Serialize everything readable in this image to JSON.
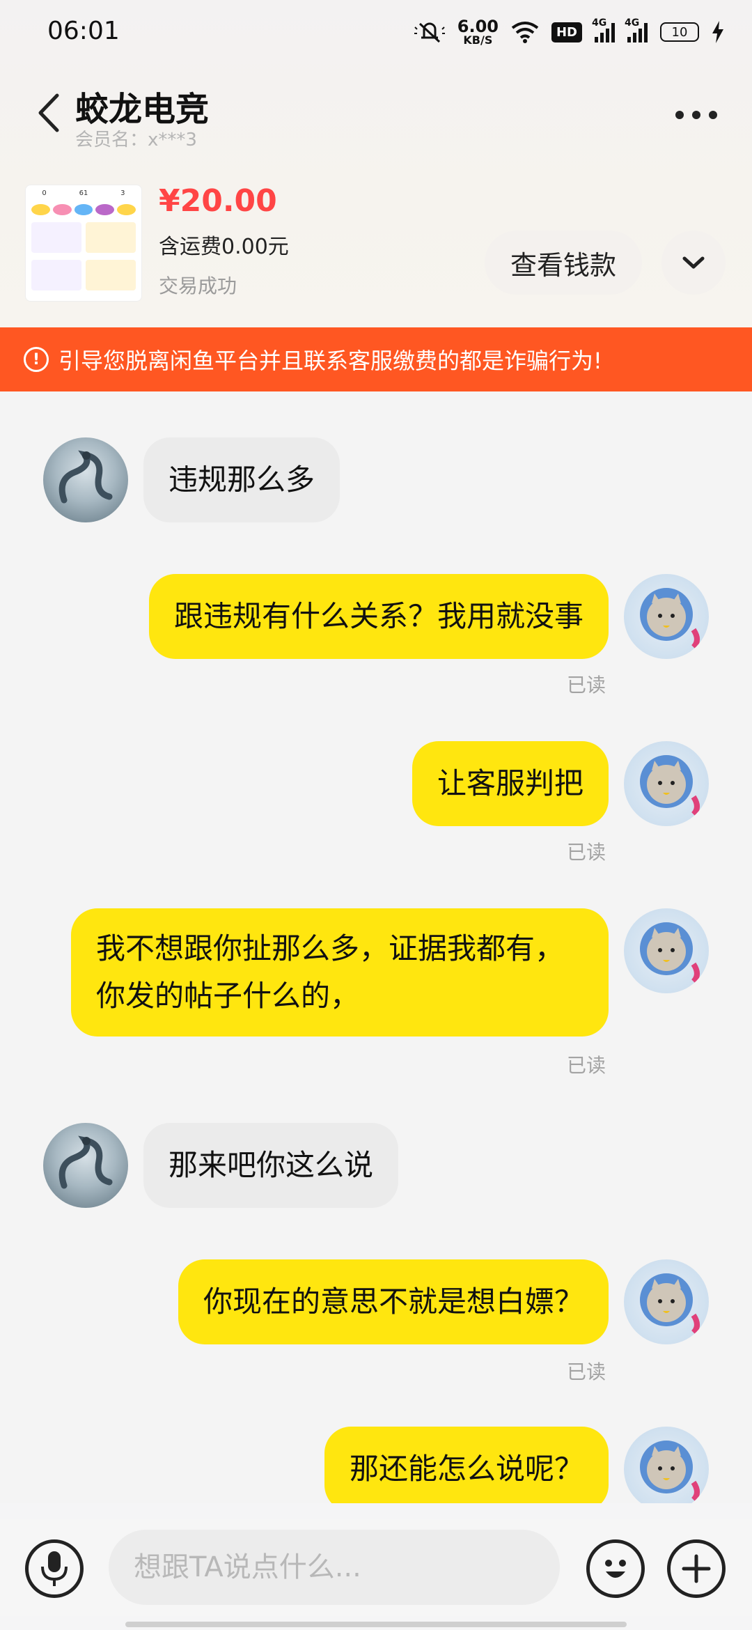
{
  "status_bar": {
    "time": "06:01",
    "net_speed_value": "6.00",
    "net_speed_unit": "KB/S",
    "hd_label": "HD",
    "signal_1_label": "4G",
    "signal_2_label": "4G",
    "battery": "10"
  },
  "header": {
    "title": "蛟龙电竞",
    "member_label": "会员名：x***3"
  },
  "product": {
    "price": "¥20.00",
    "shipping": "含运费0.00元",
    "status": "交易成功",
    "view_button": "查看钱款",
    "thumb_stats": [
      "0",
      "61",
      "3"
    ]
  },
  "warning": {
    "text": "引导您脱离闲鱼平台并且联系客服缴费的都是诈骗行为!"
  },
  "messages": [
    {
      "side": "in",
      "text": "违规那么多"
    },
    {
      "side": "out",
      "text": "跟违规有什么关系？我用就没事",
      "read": "已读"
    },
    {
      "side": "out",
      "text": "让客服判把",
      "read": "已读"
    },
    {
      "side": "out",
      "text": "我不想跟你扯那么多，证据我都有，你发的帖子什么的，",
      "read": "已读"
    },
    {
      "side": "in",
      "text": "那来吧你这么说"
    },
    {
      "side": "out",
      "text": "你现在的意思不就是想白嫖？",
      "read": "已读"
    },
    {
      "side": "out",
      "text": "那还能怎么说呢？"
    }
  ],
  "input": {
    "placeholder": "想跟TA说点什么..."
  },
  "colors": {
    "outgoing_bubble": "#ffe60f",
    "incoming_bubble": "#ebebeb",
    "warning_banner": "#ff5722",
    "price": "#ff4545"
  },
  "icons": [
    "back-arrow-icon",
    "more-dots-icon",
    "chevron-down-icon",
    "alert-circle-icon",
    "microphone-icon",
    "emoji-icon",
    "plus-icon",
    "wifi-icon",
    "mute-bell-icon",
    "charging-icon"
  ]
}
